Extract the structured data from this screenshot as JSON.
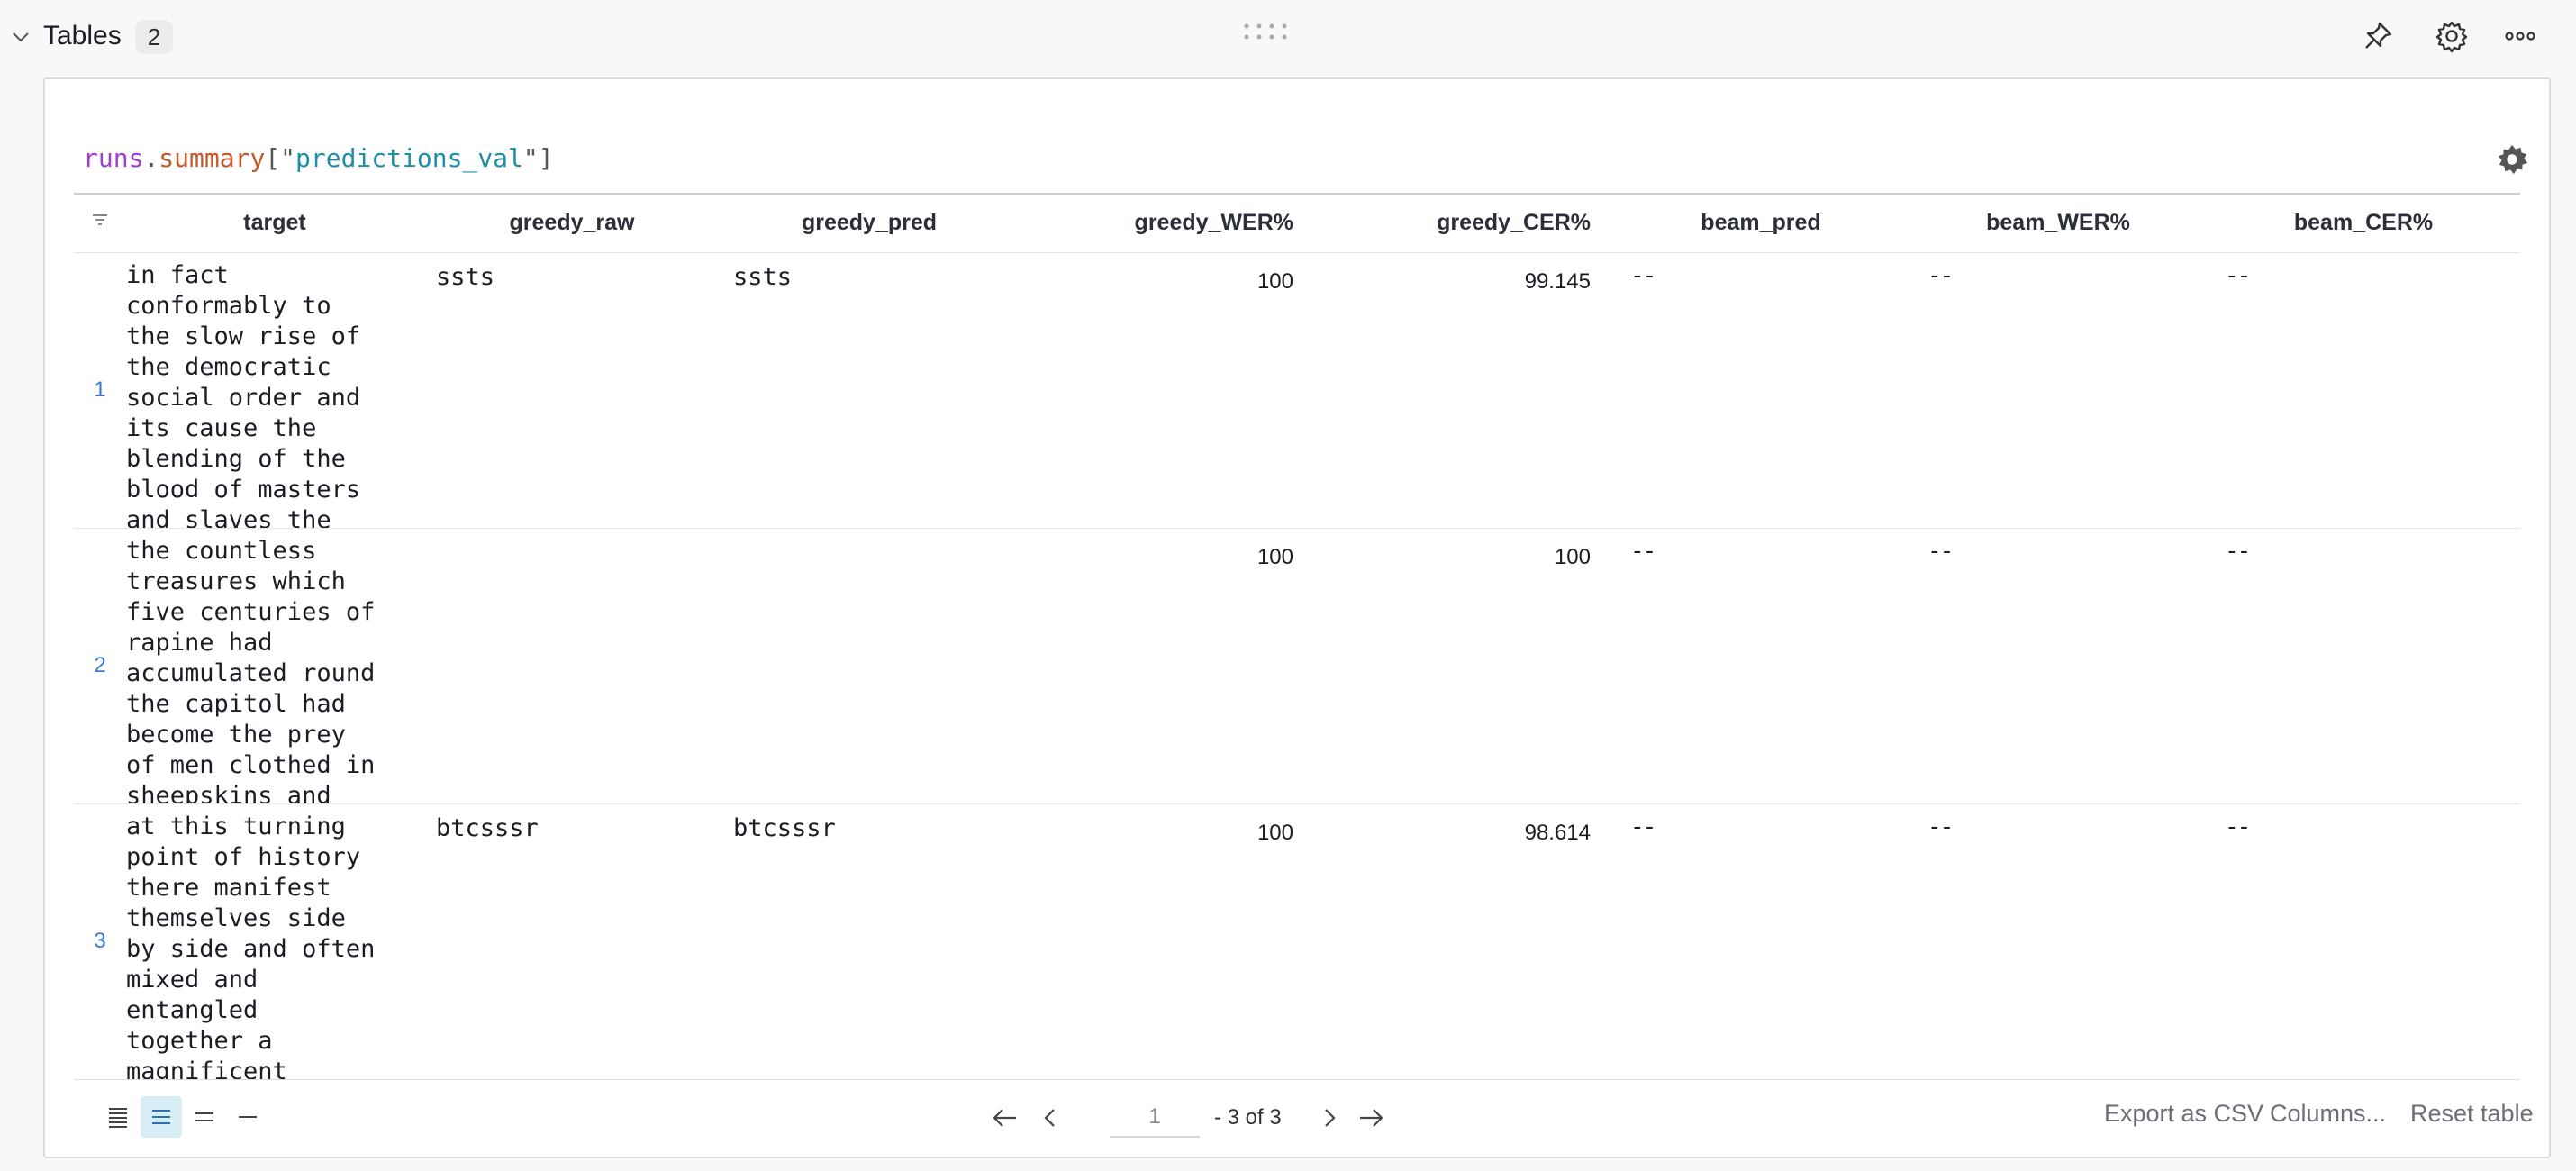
{
  "section": {
    "title": "Tables",
    "count": "2"
  },
  "query": {
    "obj": "runs",
    "dot": ".",
    "attr": "summary",
    "open": "[\"",
    "key": "predictions_val",
    "close": "\"]"
  },
  "table": {
    "columns": [
      "target",
      "greedy_raw",
      "greedy_pred",
      "greedy_WER%",
      "greedy_CER%",
      "beam_pred",
      "beam_WER%",
      "beam_CER%"
    ],
    "rows": [
      {
        "index": "1",
        "target": "in fact conformably to the slow rise of the democratic social order and its cause the blending of the blood of masters and slaves the",
        "greedy_raw": "ssts",
        "greedy_pred": "ssts",
        "greedy_wer": "100",
        "greedy_cer": "99.145",
        "beam_pred": "--",
        "beam_wer": "--",
        "beam_cer": "--"
      },
      {
        "index": "2",
        "target": "the countless treasures which five centuries of rapine had accumulated round the capitol had become the prey of men clothed in sheepskins and",
        "greedy_raw": "",
        "greedy_pred": "",
        "greedy_wer": "100",
        "greedy_cer": "100",
        "beam_pred": "--",
        "beam_wer": "--",
        "beam_cer": "--"
      },
      {
        "index": "3",
        "target": "at this turning point of history there manifest themselves side by side and often mixed and entangled together a magnificent",
        "greedy_raw": "btcsssr",
        "greedy_pred": "btcsssr",
        "greedy_wer": "100",
        "greedy_cer": "98.614",
        "beam_pred": "--",
        "beam_wer": "--",
        "beam_cer": "--"
      }
    ]
  },
  "pagination": {
    "page": "1",
    "total": "- 3 of 3"
  },
  "footer": {
    "export": "Export as CSV",
    "columns": "Columns...",
    "reset": "Reset table"
  },
  "icons": [
    "chevron-down-icon",
    "drag-handle-icon",
    "pin-icon",
    "gear-icon",
    "more-icon",
    "filter-icon",
    "arrow-left-icon",
    "chevron-left-icon",
    "chevron-right-icon",
    "arrow-right-icon"
  ],
  "colors": {
    "link_index": "#3a7bd5",
    "density_active": "#d7eef5"
  }
}
